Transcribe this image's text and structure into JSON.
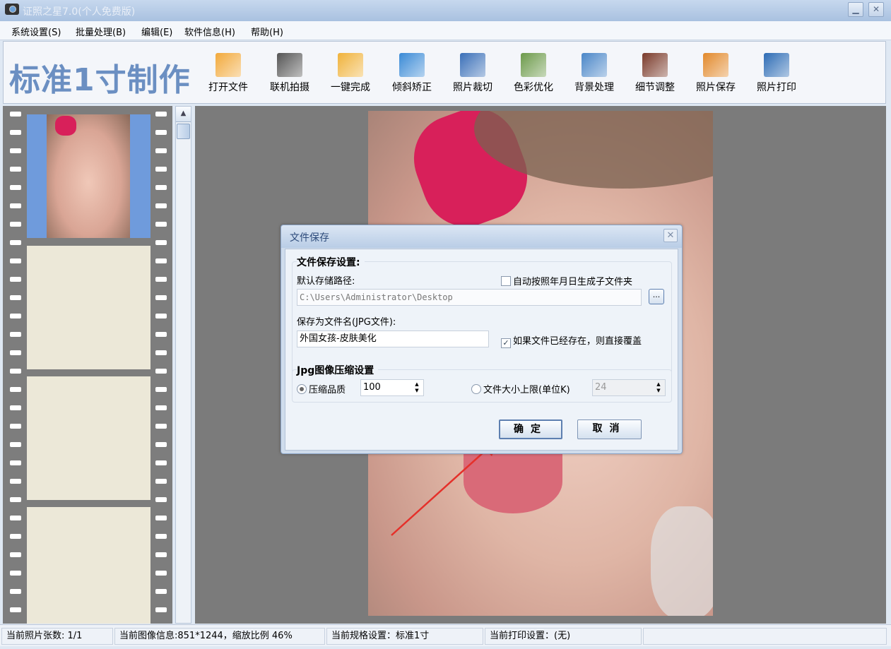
{
  "window": {
    "title": "证照之星7.0(个人免费版)"
  },
  "menu": [
    "系统设置(S)",
    "批量处理(B)",
    "编辑(E)",
    "软件信息(H)",
    "帮助(H)"
  ],
  "toolbar": {
    "brand": "标准1寸制作",
    "buttons": [
      {
        "label": "打开文件",
        "icon": "folder-icon",
        "color": "#f2a93b"
      },
      {
        "label": "联机拍摄",
        "icon": "camera-icon",
        "color": "#555555"
      },
      {
        "label": "一键完成",
        "icon": "hand-icon",
        "color": "#f0b23a"
      },
      {
        "label": "倾斜矫正",
        "icon": "rotate-icon",
        "color": "#3a8ad6"
      },
      {
        "label": "照片裁切",
        "icon": "crop-icon",
        "color": "#3a6fb8"
      },
      {
        "label": "色彩优化",
        "icon": "color-icon",
        "color": "#6c9a4a"
      },
      {
        "label": "背景处理",
        "icon": "brush-icon",
        "color": "#4a86c8"
      },
      {
        "label": "细节调整",
        "icon": "histogram-icon",
        "color": "#7a3a2a"
      },
      {
        "label": "照片保存",
        "icon": "save-icon",
        "color": "#e2892b"
      },
      {
        "label": "照片打印",
        "icon": "printer-icon",
        "color": "#2d6cb5"
      }
    ]
  },
  "dialog": {
    "title": "文件保存",
    "group1": "文件保存设置:",
    "path_label": "默认存储路径:",
    "auto_subfolder": "自动按照年月日生成子文件夹",
    "path_value": "C:\\Users\\Administrator\\Desktop",
    "browse": "...",
    "filename_label": "保存为文件名(JPG文件):",
    "filename_value": "外国女孩-皮肤美化",
    "overwrite": "如果文件已经存在，则直接覆盖",
    "group2": "Jpg图像压缩设置",
    "quality_label": "压缩品质",
    "quality_value": "100",
    "size_label": "文件大小上限(单位K)",
    "size_value": "24",
    "ok": "确定",
    "cancel": "取消"
  },
  "status": [
    "当前照片张数: 1/1",
    "当前图像信息:851*1244，缩放比例 46%",
    "当前规格设置：标准1寸",
    "当前打印设置：(无)",
    ""
  ]
}
